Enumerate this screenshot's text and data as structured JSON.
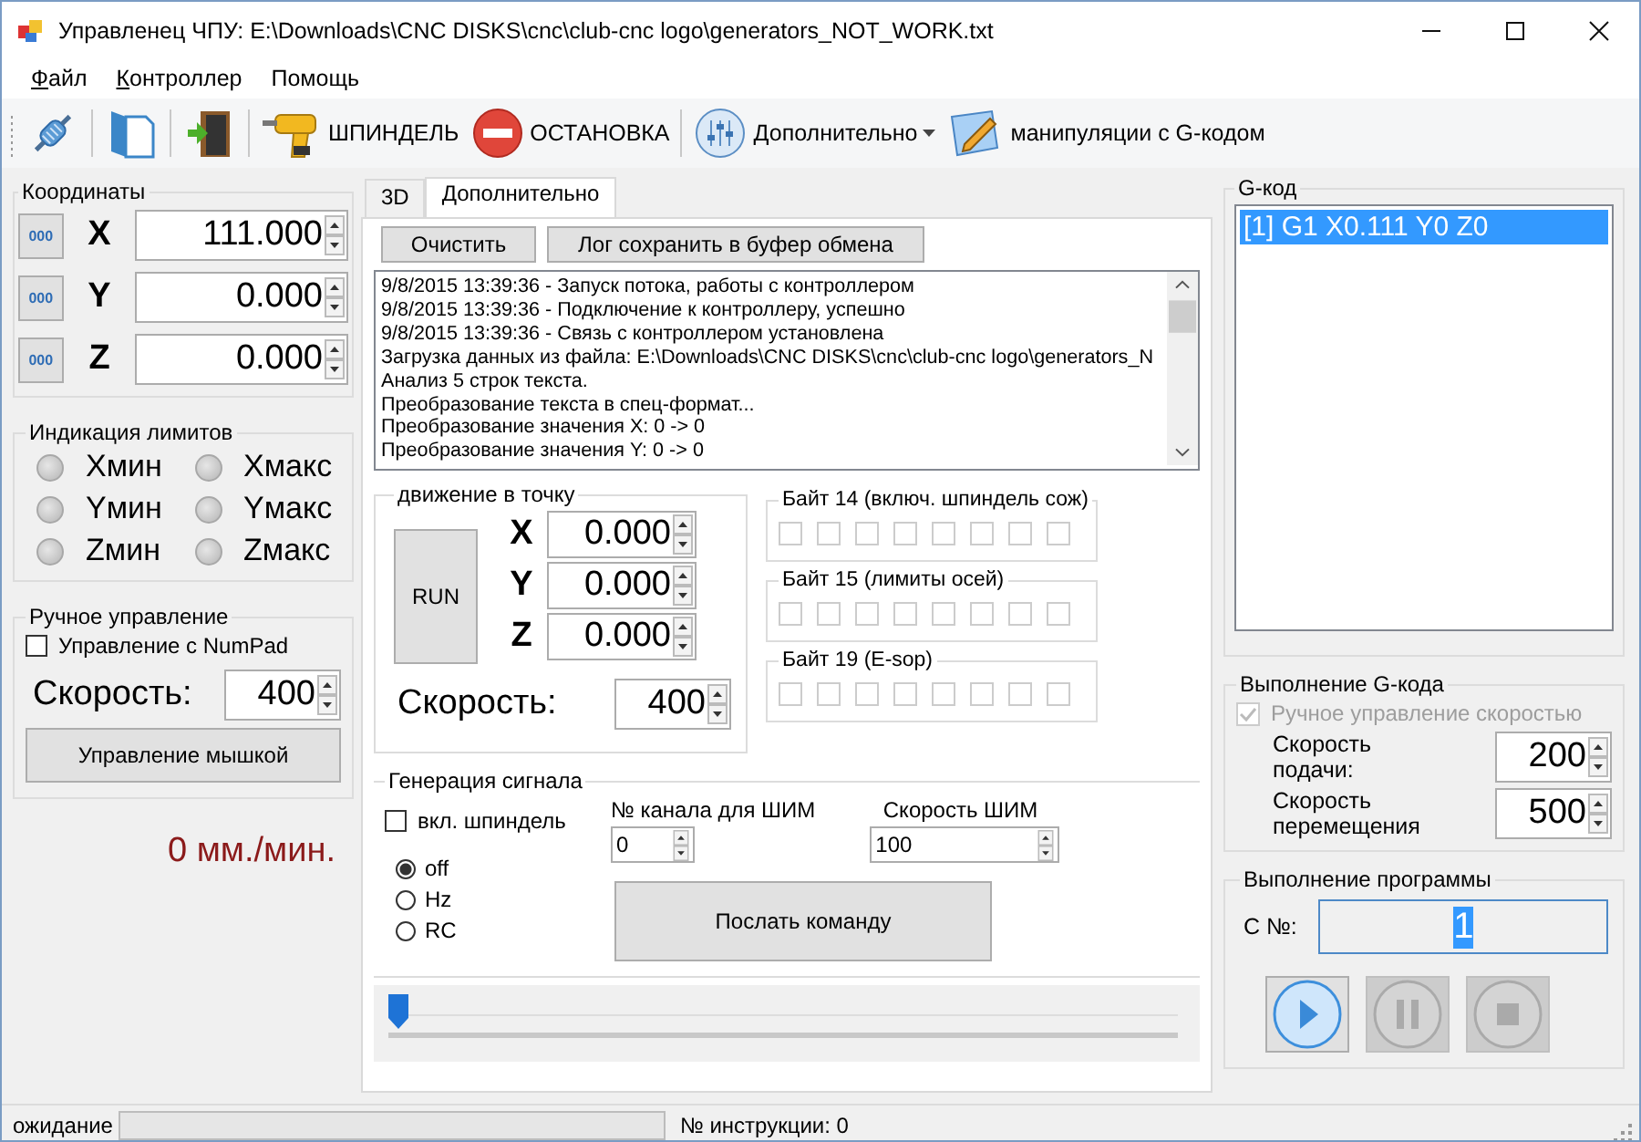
{
  "window": {
    "title": "Управленец ЧПУ: E:\\Downloads\\CNC DISKS\\cnc\\club-cnc logo\\generators_NOT_WORK.txt"
  },
  "menu": [
    {
      "label": "Файл",
      "mnemonic": true
    },
    {
      "label": "Контроллер",
      "mnemonic": true
    },
    {
      "label": "Помощь",
      "mnemonic": false
    }
  ],
  "toolbar": [
    {
      "items": [
        {
          "kind": "button"
        }
      ]
    },
    {
      "items": [
        {
          "kind": "button"
        }
      ]
    },
    {
      "items": [
        {
          "kind": "button"
        }
      ]
    },
    {
      "items": [
        {
          "kind": "button",
          "label": "ШПИНДЕЛЬ"
        },
        {
          "kind": "button",
          "label": "ОСТАНОВКА"
        }
      ]
    },
    {
      "items": [
        {
          "kind": "dropdown",
          "label": "Дополнительно"
        },
        {
          "kind": "button",
          "label": "манипуляции с G-кодом"
        }
      ]
    }
  ],
  "coordinates": {
    "title": "Координаты",
    "rows": [
      {
        "zero_label": "000",
        "axis": "X",
        "value": "111.000"
      },
      {
        "zero_label": "000",
        "axis": "Y",
        "value": "0.000"
      },
      {
        "zero_label": "000",
        "axis": "Z",
        "value": "0.000"
      }
    ]
  },
  "limits": {
    "title": "Индикация лимитов",
    "items": [
      {
        "label": "Xмин",
        "on": false
      },
      {
        "label": "Xмакс",
        "on": false
      },
      {
        "label": "Yмин",
        "on": false
      },
      {
        "label": "Yмакс",
        "on": false
      },
      {
        "label": "Zмин",
        "on": false
      },
      {
        "label": "Zмакс",
        "on": false
      }
    ]
  },
  "manual": {
    "title": "Ручное управление",
    "numpad": {
      "label": "Управление с NumPad",
      "checked": false
    },
    "speed_label": "Скорость:",
    "speed": "400",
    "mouse_button": "Управление мышкой",
    "feed_readout": "0 мм./мин."
  },
  "tabs": [
    {
      "label": "3D",
      "selected": false
    },
    {
      "label": "Дополнительно",
      "selected": true
    }
  ],
  "log": {
    "buttons": [
      "Очистить",
      "Лог сохранить в буфер обмена"
    ],
    "lines": [
      "9/8/2015 13:39:36 - Запуск потока, работы с контроллером",
      "9/8/2015 13:39:36 - Подключение к контроллеру, успешно",
      "9/8/2015 13:39:36 - Связь с контроллером установлена",
      "Загрузка данных из файла: E:\\Downloads\\CNC DISKS\\cnc\\club-cnc logo\\generators_N",
      "Анализ 5 строк текста.",
      "Преобразование текста в спец-формат...",
      "Преобразование значения X: 0 -> 0",
      "Преобразование значения Y: 0 -> 0"
    ]
  },
  "move": {
    "title": "движение в точку",
    "run_button": "RUN",
    "axes": [
      {
        "axis": "X",
        "value": "0.000"
      },
      {
        "axis": "Y",
        "value": "0.000"
      },
      {
        "axis": "Z",
        "value": "0.000"
      }
    ],
    "speed_label": "Скорость:",
    "speed": "400"
  },
  "bytes": [
    {
      "title": "Байт 14 (включ. шпиндель сож)",
      "bits": [
        {
          "checked": false
        },
        {
          "checked": false
        },
        {
          "checked": false
        },
        {
          "checked": false
        },
        {
          "checked": false
        },
        {
          "checked": false
        },
        {
          "checked": false
        },
        {
          "checked": false
        }
      ]
    },
    {
      "title": "Байт 15 (лимиты осей)",
      "bits": [
        {
          "checked": false
        },
        {
          "checked": false
        },
        {
          "checked": false
        },
        {
          "checked": false
        },
        {
          "checked": false
        },
        {
          "checked": false
        },
        {
          "checked": false
        },
        {
          "checked": false
        }
      ]
    },
    {
      "title": "Байт 19 (E-sop)",
      "bits": [
        {
          "checked": false
        },
        {
          "checked": false
        },
        {
          "checked": false
        },
        {
          "checked": false
        },
        {
          "checked": false
        },
        {
          "checked": false
        },
        {
          "checked": false
        },
        {
          "checked": false
        }
      ]
    }
  ],
  "signal": {
    "title": "Генерация сигнала",
    "spindle": {
      "label": "вкл. шпиндель",
      "checked": false
    },
    "modes": [
      {
        "label": "off",
        "selected": true
      },
      {
        "label": "Hz",
        "selected": false
      },
      {
        "label": "RC",
        "selected": false
      }
    ],
    "channel_label": "№ канала для ШИМ",
    "channel": "0",
    "pwm_label": "Скорость ШИМ",
    "pwm": "100",
    "send_button": "Послать команду"
  },
  "slider": {
    "level": 0
  },
  "gcode": {
    "title": "G-код",
    "lines": [
      {
        "text": "[1] G1 X0.111 Y0 Z0",
        "selected": true
      }
    ]
  },
  "execution": {
    "title": "Выполнение G-кода",
    "manual_speed": {
      "label": "Ручное управление скоростью",
      "checked": true,
      "disabled": true
    },
    "feed_label": "Скорость подачи:",
    "feed": "200",
    "travel_label": "Скорость перемещения",
    "travel": "500"
  },
  "program": {
    "title": "Выполнение программы",
    "from_label": "С №:",
    "from": "1",
    "from_selected": true,
    "buttons": [
      {
        "kind": "play",
        "disabled": false
      },
      {
        "kind": "pause",
        "disabled": true
      },
      {
        "kind": "stop",
        "disabled": true
      }
    ]
  },
  "status_bar": {
    "state": "ожидание",
    "progress": {
      "level": 0
    },
    "instruction": "№ инструкции: 0"
  }
}
